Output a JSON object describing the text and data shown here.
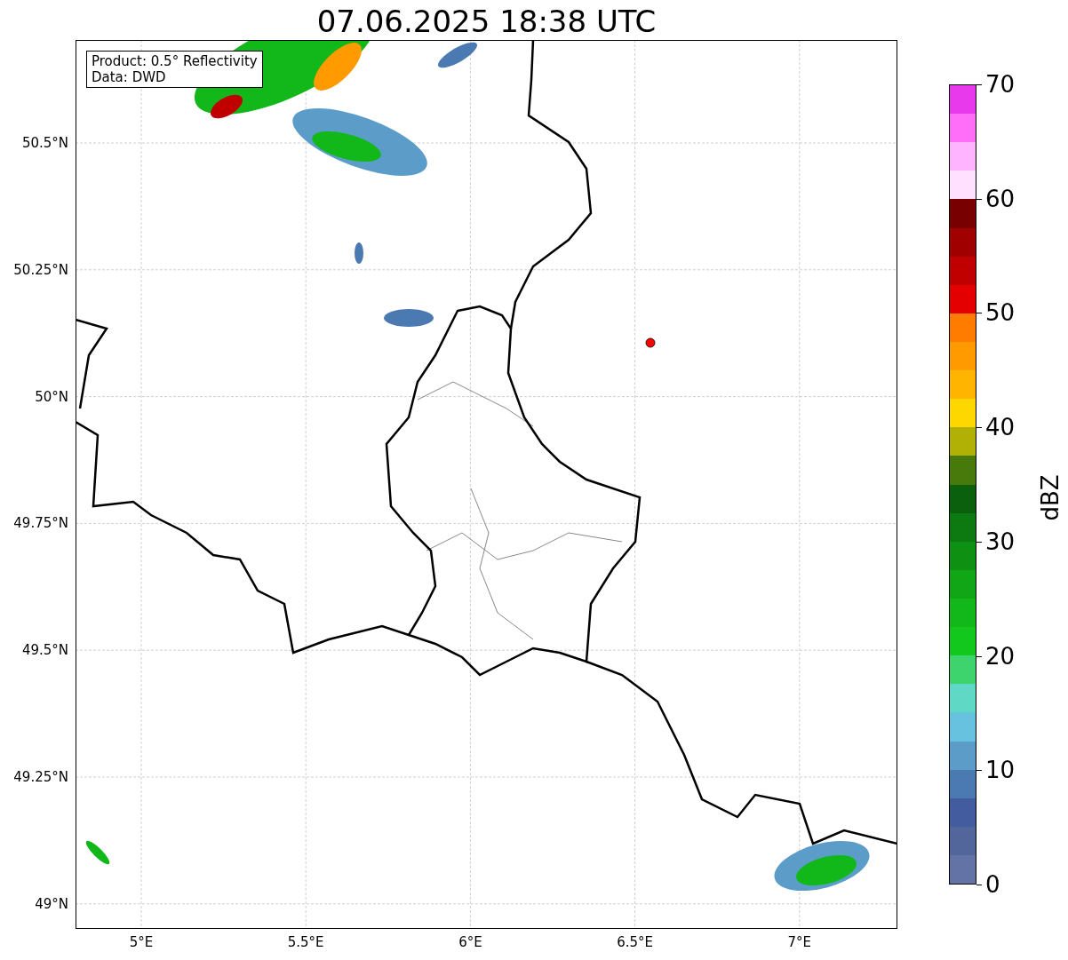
{
  "title": "07.06.2025 18:38 UTC",
  "info_box": [
    "Product: 0.5° Reflectivity",
    "Data: DWD"
  ],
  "map": {
    "lat_labels": [
      "50.5°N",
      "50.25°N",
      "50°N",
      "49.75°N",
      "49.5°N",
      "49.25°N",
      "49°N"
    ],
    "lon_labels": [
      "5°E",
      "5.5°E",
      "6°E",
      "6.5°E",
      "7°E"
    ]
  },
  "colorbar": {
    "label": "dBZ",
    "ticks": [
      "70",
      "60",
      "50",
      "40",
      "30",
      "20",
      "10",
      "0"
    ],
    "bands": [
      {
        "color": "#e83aec"
      },
      {
        "color": "#ff6ef8"
      },
      {
        "color": "#ffb4ff"
      },
      {
        "color": "#ffe0ff"
      },
      {
        "color": "#780000"
      },
      {
        "color": "#a00000"
      },
      {
        "color": "#c00000"
      },
      {
        "color": "#e40000"
      },
      {
        "color": "#ff7c00"
      },
      {
        "color": "#ff9a00"
      },
      {
        "color": "#ffb400"
      },
      {
        "color": "#ffd700"
      },
      {
        "color": "#b0b005"
      },
      {
        "color": "#487a0b"
      },
      {
        "color": "#0a600c"
      },
      {
        "color": "#0c7a10"
      },
      {
        "color": "#0e9112"
      },
      {
        "color": "#10a615"
      },
      {
        "color": "#12b81a"
      },
      {
        "color": "#12c81c"
      },
      {
        "color": "#3dd46e"
      },
      {
        "color": "#5fd8c6"
      },
      {
        "color": "#66c2de"
      },
      {
        "color": "#5b9dc8"
      },
      {
        "color": "#4b7ab3"
      },
      {
        "color": "#435ca0"
      },
      {
        "color": "#53669c"
      },
      {
        "color": "#6373a6"
      }
    ]
  }
}
